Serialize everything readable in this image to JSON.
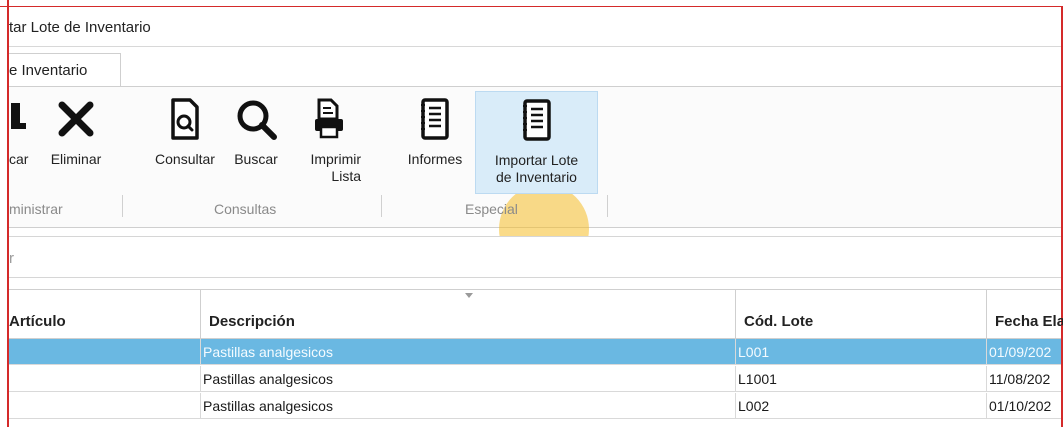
{
  "window": {
    "title": "tar Lote de Inventario"
  },
  "tabs": [
    {
      "label": "e Inventario"
    }
  ],
  "ribbon": {
    "groups": [
      {
        "label": "ministrar",
        "buttons": [
          {
            "label": "car",
            "icon": "edit-icon"
          },
          {
            "label": "Eliminar",
            "icon": "delete-x-icon"
          }
        ]
      },
      {
        "label": "Consultas",
        "buttons": [
          {
            "label": "Consultar",
            "icon": "document-search-icon"
          },
          {
            "label": "Buscar",
            "icon": "magnifier-icon"
          },
          {
            "label": "Imprimir Lista",
            "label_line1": "Imprimir",
            "label_line2": "Lista",
            "icon": "printer-icon"
          }
        ]
      },
      {
        "label": "Especial",
        "buttons": [
          {
            "label": "Informes",
            "icon": "notebook-icon"
          },
          {
            "label": "Importar Lote de Inventario",
            "label_line1": "Importar Lote",
            "label_line2": "de Inventario",
            "icon": "import-notebook-icon",
            "state": "hover"
          }
        ]
      }
    ]
  },
  "search": {
    "placeholder": "r"
  },
  "grid": {
    "columns": [
      "Artículo",
      "Descripción",
      "Cód. Lote",
      "Fecha Ela"
    ],
    "rows": [
      {
        "articulo": "",
        "descripcion": "Pastillas analgesicos",
        "cod_lote": "L001",
        "fecha": "01/09/202",
        "selected": true
      },
      {
        "articulo": "",
        "descripcion": "Pastillas analgesicos",
        "cod_lote": "L1001",
        "fecha": "11/08/202",
        "selected": false
      },
      {
        "articulo": "",
        "descripcion": "Pastillas analgesicos",
        "cod_lote": "L002",
        "fecha": "01/10/202",
        "selected": false
      }
    ]
  },
  "colors": {
    "accent_selection": "#6ab8e2",
    "window_border": "#d42a2a",
    "hover_button": "#d9ecf9",
    "cursor_halo": "#f5be28"
  }
}
